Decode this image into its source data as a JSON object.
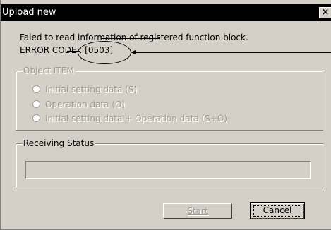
{
  "window": {
    "title": "Upload new",
    "close_label": "×"
  },
  "message": {
    "line1": "Faied to read information of registered function block.",
    "line2": "ERROR CODE : [0503]"
  },
  "object_item": {
    "legend": "Object ITEM",
    "options": [
      {
        "label": "Initial setting data (S)",
        "selected": false,
        "enabled": false
      },
      {
        "label": "Operation data (O)",
        "selected": false,
        "enabled": false
      },
      {
        "label": "Initial setting data + Operation data (S+O)",
        "selected": false,
        "enabled": false
      }
    ]
  },
  "receiving_status": {
    "legend": "Receiving Status",
    "progress": 0
  },
  "buttons": {
    "start_label": "Start",
    "cancel_label": "Cancel"
  }
}
